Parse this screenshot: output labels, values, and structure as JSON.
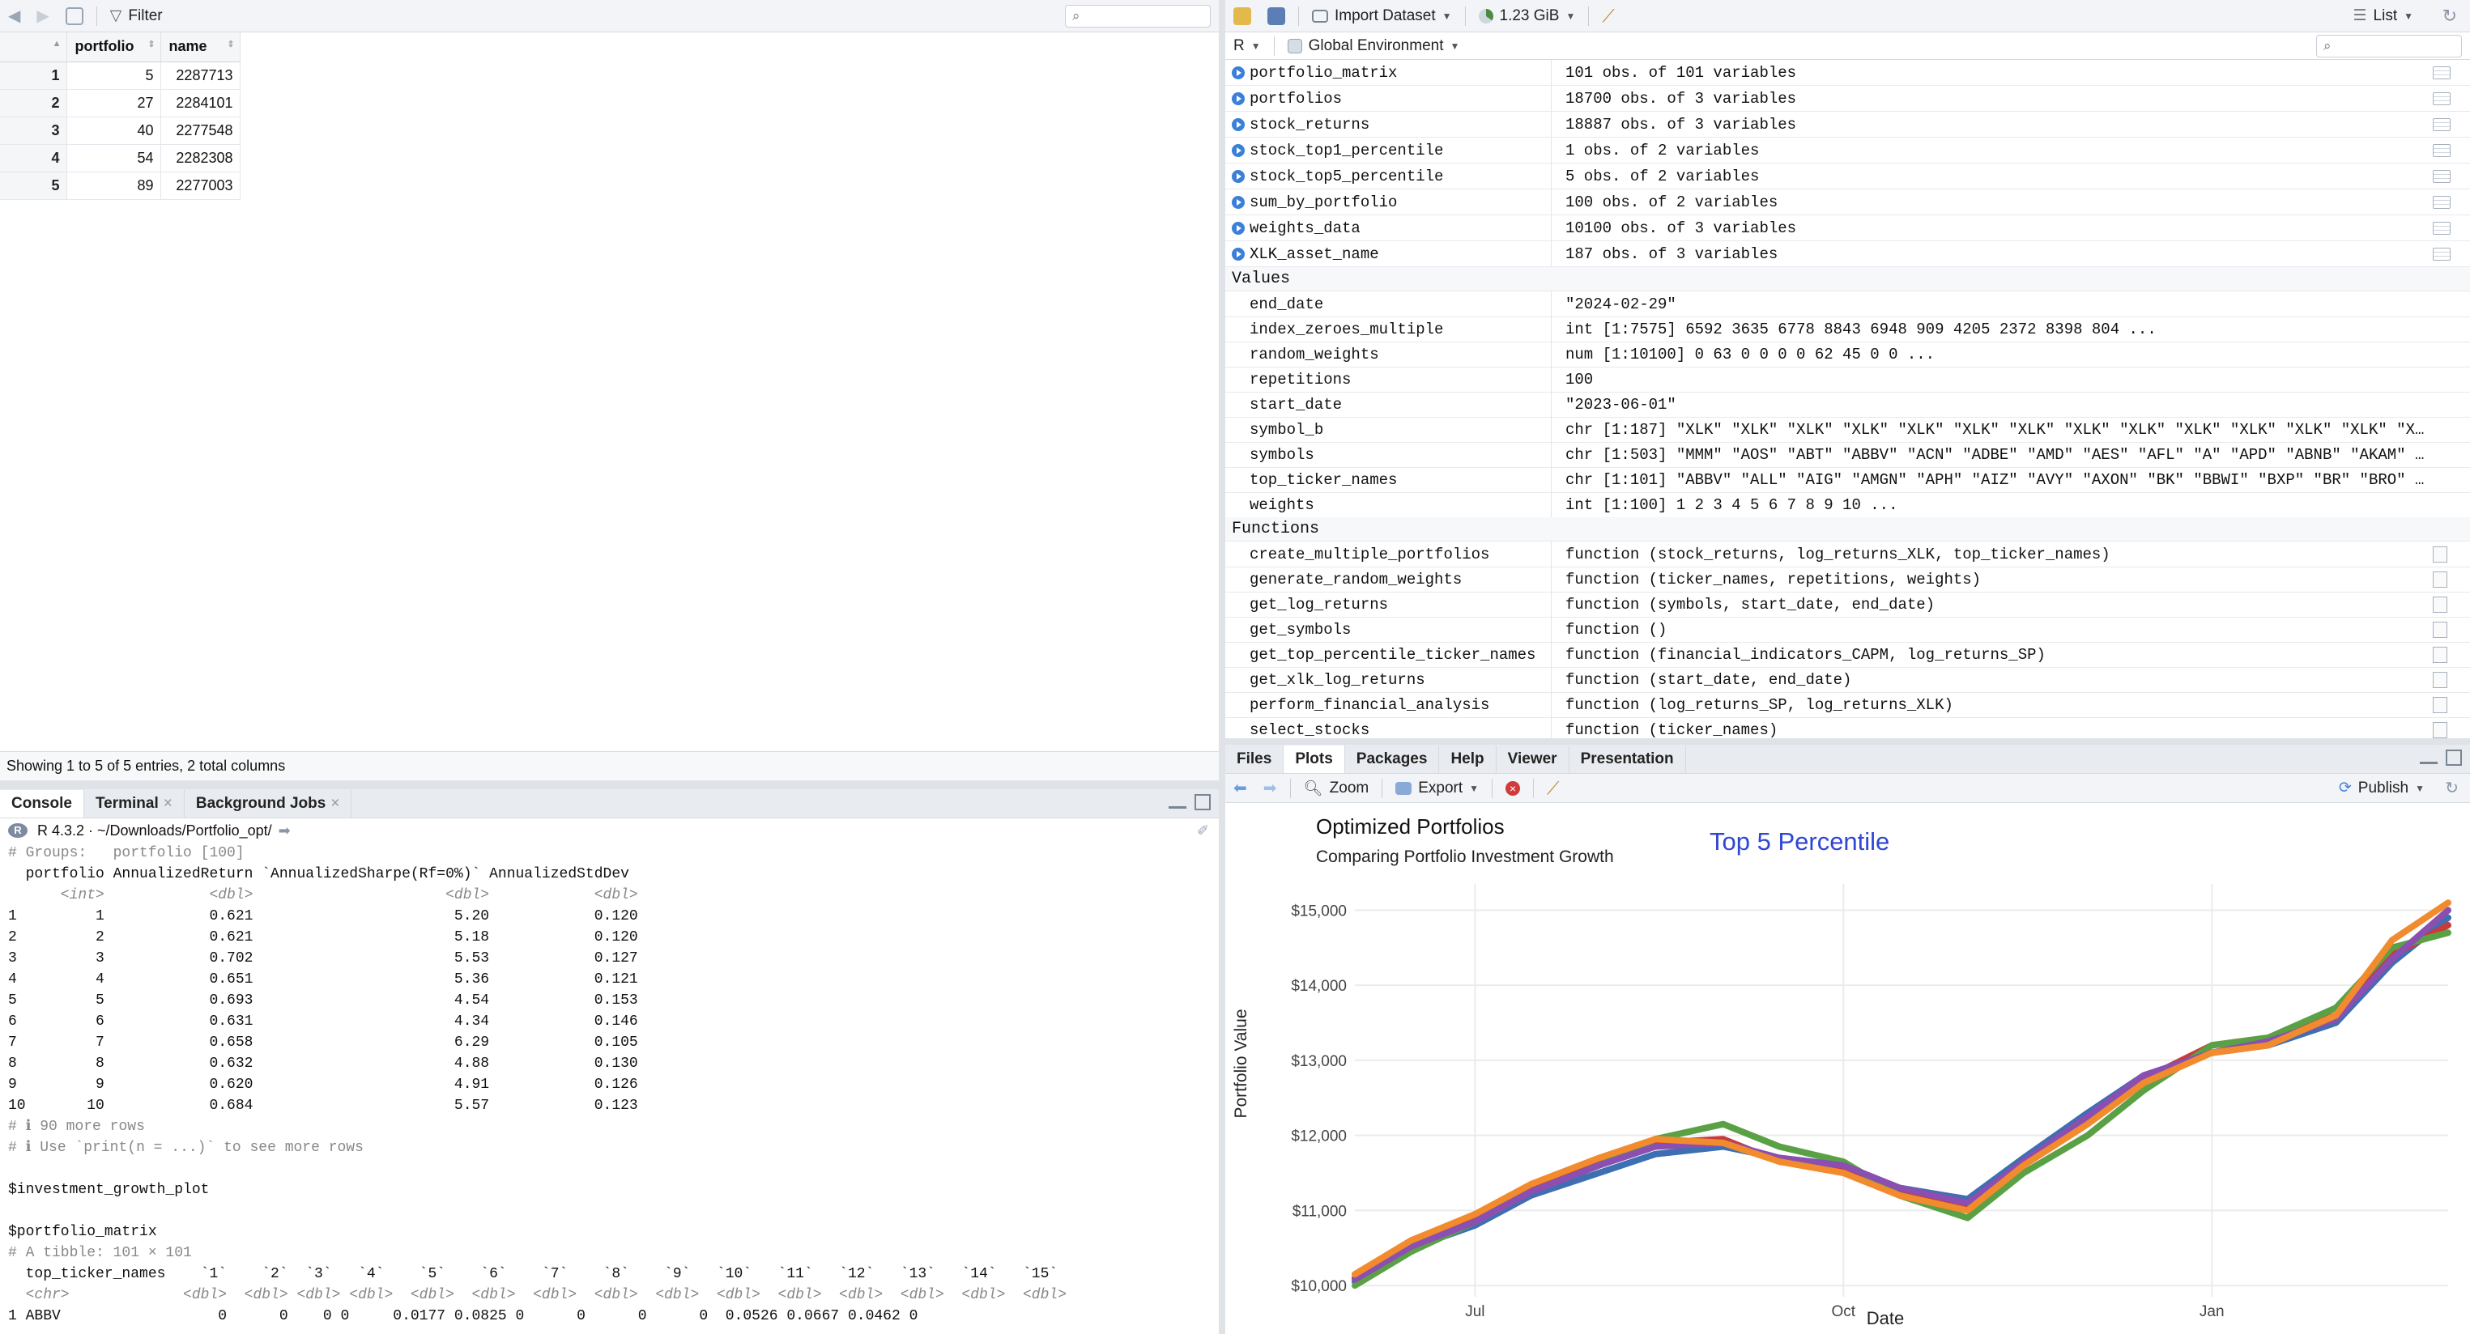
{
  "viewer": {
    "filter_label": "Filter",
    "columns": [
      "portfolio",
      "name"
    ],
    "rows": [
      {
        "rn": "1",
        "portfolio": "5",
        "name": "2287713"
      },
      {
        "rn": "2",
        "portfolio": "27",
        "name": "2284101"
      },
      {
        "rn": "3",
        "portfolio": "40",
        "name": "2277548"
      },
      {
        "rn": "4",
        "portfolio": "54",
        "name": "2282308"
      },
      {
        "rn": "5",
        "portfolio": "89",
        "name": "2277003"
      }
    ],
    "status": "Showing 1 to 5 of 5 entries, 2 total columns"
  },
  "env": {
    "import_label": "Import Dataset",
    "memory_label": "1.23 GiB",
    "list_label": "List",
    "lang_label": "R",
    "scope_label": "Global Environment",
    "data_rows": [
      {
        "name": "portfolio_matrix",
        "value": "101 obs. of 101 variables"
      },
      {
        "name": "portfolios",
        "value": "18700 obs. of 3 variables"
      },
      {
        "name": "stock_returns",
        "value": "18887 obs. of 3 variables"
      },
      {
        "name": "stock_top1_percentile",
        "value": "1 obs. of 2 variables"
      },
      {
        "name": "stock_top5_percentile",
        "value": "5 obs. of 2 variables"
      },
      {
        "name": "sum_by_portfolio",
        "value": "100 obs. of 2 variables"
      },
      {
        "name": "weights_data",
        "value": "10100 obs. of 3 variables"
      },
      {
        "name": "XLK_asset_name",
        "value": "187 obs. of 3 variables"
      }
    ],
    "values_header": "Values",
    "value_rows": [
      {
        "name": "end_date",
        "value": "\"2024-02-29\""
      },
      {
        "name": "index_zeroes_multiple",
        "value": "int [1:7575] 6592 3635 6778 8843 6948 909 4205 2372 8398 804 ..."
      },
      {
        "name": "random_weights",
        "value": "num [1:10100] 0 63 0 0 0 0 62 45 0 0 ..."
      },
      {
        "name": "repetitions",
        "value": "100"
      },
      {
        "name": "start_date",
        "value": "\"2023-06-01\""
      },
      {
        "name": "symbol_b",
        "value": "chr [1:187] \"XLK\" \"XLK\" \"XLK\" \"XLK\" \"XLK\" \"XLK\" \"XLK\" \"XLK\" \"XLK\" \"XLK\" \"XLK\" \"XLK\" \"XLK\" \"XLK\" \"XLK\" \"XL…"
      },
      {
        "name": "symbols",
        "value": "chr [1:503] \"MMM\" \"AOS\" \"ABT\" \"ABBV\" \"ACN\" \"ADBE\" \"AMD\" \"AES\" \"AFL\" \"A\" \"APD\" \"ABNB\" \"AKAM\" \"ALB\" \"…"
      },
      {
        "name": "top_ticker_names",
        "value": "chr [1:101] \"ABBV\" \"ALL\" \"AIG\" \"AMGN\" \"APH\" \"AIZ\" \"AVY\" \"AXON\" \"BK\" \"BBWI\" \"BXP\" \"BR\" \"BRO\" \"BLDR\" \"…"
      },
      {
        "name": "weights",
        "value": "int [1:100] 1 2 3 4 5 6 7 8 9 10 ..."
      }
    ],
    "functions_header": "Functions",
    "function_rows": [
      {
        "name": "create_multiple_portfolios",
        "value": "function (stock_returns, log_returns_XLK, top_ticker_names)"
      },
      {
        "name": "generate_random_weights",
        "value": "function (ticker_names, repetitions, weights)"
      },
      {
        "name": "get_log_returns",
        "value": "function (symbols, start_date, end_date)"
      },
      {
        "name": "get_symbols",
        "value": "function ()"
      },
      {
        "name": "get_top_percentile_ticker_names",
        "value": "function (financial_indicators_CAPM, log_returns_SP)"
      },
      {
        "name": "get_xlk_log_returns",
        "value": "function (start_date, end_date)"
      },
      {
        "name": "perform_financial_analysis",
        "value": "function (log_returns_SP, log_returns_XLK)"
      },
      {
        "name": "select_stocks",
        "value": "function (ticker_names)"
      }
    ]
  },
  "console": {
    "tabs": [
      "Console",
      "Terminal",
      "Background Jobs"
    ],
    "r_version": "R 4.3.2 · ~/Downloads/Portfolio_opt/",
    "lines": [
      "# Groups:   portfolio [100]",
      "  portfolio AnnualizedReturn `AnnualizedSharpe(Rf=0%)` AnnualizedStdDev",
      "      <int>            <dbl>                      <dbl>            <dbl>",
      "1         1            0.621                       5.20            0.120",
      "2         2            0.621                       5.18            0.120",
      "3         3            0.702                       5.53            0.127",
      "4         4            0.651                       5.36            0.121",
      "5         5            0.693                       4.54            0.153",
      "6         6            0.631                       4.34            0.146",
      "7         7            0.658                       6.29            0.105",
      "8         8            0.632                       4.88            0.130",
      "9         9            0.620                       4.91            0.126",
      "10       10            0.684                       5.57            0.123",
      "# ℹ 90 more rows",
      "# ℹ Use `print(n = ...)` to see more rows",
      "",
      "$investment_growth_plot",
      "",
      "$portfolio_matrix",
      "# A tibble: 101 × 101",
      "  top_ticker_names    `1`    `2`  `3`   `4`    `5`    `6`    `7`    `8`    `9`   `10`   `11`   `12`   `13`   `14`   `15`",
      "  <chr>             <dbl>  <dbl> <dbl> <dbl>  <dbl>  <dbl>  <dbl>  <dbl>  <dbl>  <dbl>  <dbl>  <dbl>  <dbl>  <dbl>  <dbl>",
      "1 ABBV                  0      0    0 0     0.0177 0.0825 0      0      0      0  0.0526 0.0667 0.0462 0"
    ]
  },
  "plots_pane": {
    "tabs": [
      "Files",
      "Plots",
      "Packages",
      "Help",
      "Viewer",
      "Presentation"
    ],
    "zoom_label": "Zoom",
    "export_label": "Export",
    "publish_label": "Publish"
  },
  "chart_data": {
    "type": "line",
    "title": "Optimized Portfolios",
    "subtitle": "Comparing Portfolio Investment Growth",
    "annotation": "Top 5 Percentile",
    "xlabel": "Date",
    "ylabel": "Portfolio Value",
    "x_ticks": [
      "Jul",
      "Oct",
      "Jan"
    ],
    "y_ticks": [
      "$10,000",
      "$11,000",
      "$12,000",
      "$13,000",
      "$14,000",
      "$15,000"
    ],
    "ylim": [
      9850,
      15350
    ],
    "xlim": [
      "2023-06-01",
      "2024-02-29"
    ],
    "grid": true,
    "x": [
      "2023-06-01",
      "2023-06-15",
      "2023-07-01",
      "2023-07-15",
      "2023-08-01",
      "2023-08-15",
      "2023-09-01",
      "2023-09-15",
      "2023-10-01",
      "2023-10-15",
      "2023-11-01",
      "2023-11-15",
      "2023-12-01",
      "2023-12-15",
      "2024-01-01",
      "2024-01-15",
      "2024-02-01",
      "2024-02-15",
      "2024-02-29"
    ],
    "series": [
      {
        "color": "#3e6fb3",
        "values": [
          10050,
          10500,
          10800,
          11200,
          11500,
          11750,
          11850,
          11700,
          11600,
          11300,
          11150,
          11700,
          12300,
          12800,
          13100,
          13200,
          13500,
          14300,
          14900
        ]
      },
      {
        "color": "#c73b3b",
        "values": [
          10100,
          10550,
          10900,
          11300,
          11650,
          11900,
          11950,
          11650,
          11550,
          11250,
          11050,
          11650,
          12200,
          12750,
          13200,
          13300,
          13600,
          14400,
          14800
        ]
      },
      {
        "color": "#5aa145",
        "values": [
          10000,
          10450,
          10850,
          11250,
          11600,
          11950,
          12150,
          11850,
          11650,
          11200,
          10900,
          11500,
          12000,
          12600,
          13200,
          13300,
          13700,
          14500,
          14700
        ]
      },
      {
        "color": "#8a4fb0",
        "values": [
          10080,
          10520,
          10850,
          11250,
          11600,
          11850,
          11900,
          11700,
          11600,
          11300,
          11100,
          11650,
          12250,
          12800,
          13100,
          13250,
          13550,
          14350,
          15000
        ]
      },
      {
        "color": "#f28a2e",
        "values": [
          10150,
          10600,
          10950,
          11350,
          11700,
          11950,
          11900,
          11650,
          11500,
          11200,
          11000,
          11600,
          12150,
          12700,
          13100,
          13200,
          13600,
          14600,
          15100
        ]
      }
    ]
  }
}
